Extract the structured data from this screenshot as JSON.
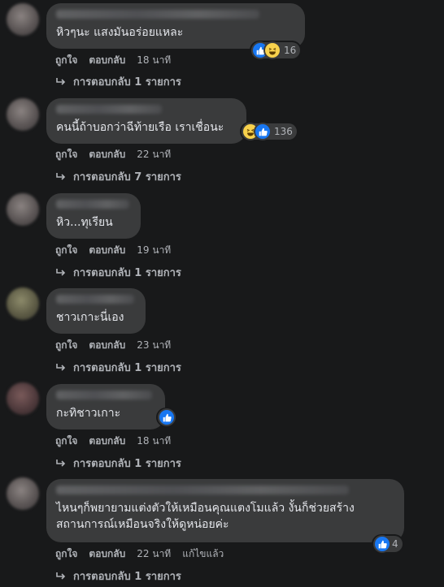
{
  "comments": [
    {
      "text": "หิวๆนะ แสงมันอร่อยแหละ",
      "reaction_count": "16",
      "like": "ถูกใจ",
      "reply": "ตอบกลับ",
      "time": "18 นาที",
      "edited": "",
      "replies": "การตอบกลับ 1 รายการ"
    },
    {
      "text": "คนนี้ถ้าบอกว่าฉีท้ายเรือ เราเชื่อนะ",
      "reaction_count": "136",
      "like": "ถูกใจ",
      "reply": "ตอบกลับ",
      "time": "22 นาที",
      "edited": "",
      "replies": "การตอบกลับ 7 รายการ"
    },
    {
      "text": "หิว...ทุเรียน",
      "reaction_count": "",
      "like": "ถูกใจ",
      "reply": "ตอบกลับ",
      "time": "19 นาที",
      "edited": "",
      "replies": "การตอบกลับ 1 รายการ"
    },
    {
      "text": "ชาวเกาะนี่เอง",
      "reaction_count": "",
      "like": "ถูกใจ",
      "reply": "ตอบกลับ",
      "time": "23 นาที",
      "edited": "",
      "replies": "การตอบกลับ 1 รายการ"
    },
    {
      "text": "กะทิชาวเกาะ",
      "reaction_count": "",
      "like": "ถูกใจ",
      "reply": "ตอบกลับ",
      "time": "18 นาที",
      "edited": "",
      "replies": "การตอบกลับ 1 รายการ"
    },
    {
      "text_line1": "ไหนๆก็พยายามแต่งตัวให้เหมือนคุณแตงโมแล้ว งั้นก็ช่วยสร้าง",
      "text_line2": "สถานการณ์เหมือนจริงให้ดูหน่อยค่ะ",
      "reaction_count": "4",
      "like": "ถูกใจ",
      "reply": "ตอบกลับ",
      "time": "22 นาที",
      "edited": "แก้ไขแล้ว",
      "replies": "การตอบกลับ 1 รายการ"
    }
  ],
  "colors": {
    "background": "#18191a",
    "bubble": "#3a3b3c",
    "like_blue": "#1877f2",
    "haha_yellow": "#f7d14c",
    "muted_text": "#b0b3b8"
  },
  "icons": [
    "like-reaction-icon",
    "haha-reaction-icon",
    "reply-arrow-icon"
  ]
}
